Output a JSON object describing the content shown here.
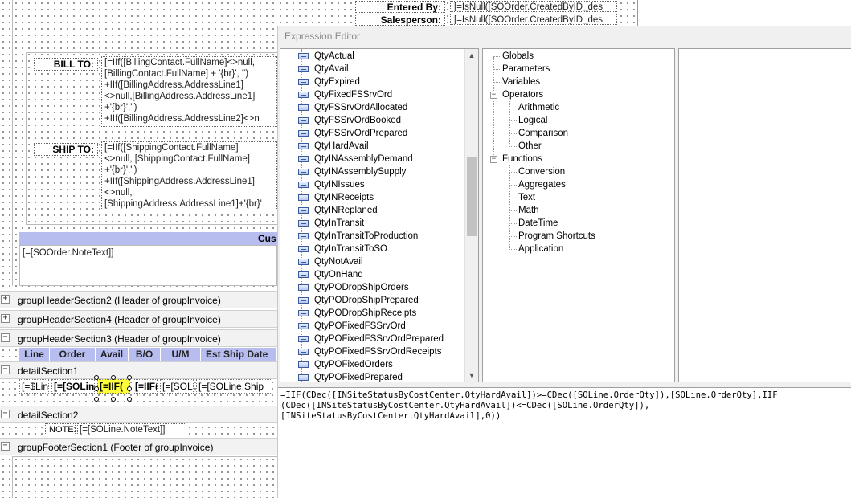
{
  "report": {
    "entered_by_label": "Entered By:",
    "entered_by_value": "[=IsNull([SOOrder.CreatedByID_des",
    "salesperson_label": "Salesperson:",
    "salesperson_value": "[=IsNull([SOOrder.CreatedByID_des",
    "bill_to_label": "BILL TO:",
    "bill_to_lines": [
      "[=IIf([BillingContact.FullName]<>null,",
      "[BillingContact.FullName] + '{br}', '')",
      "+IIf([BillingAddress.AddressLine1]",
      "<>null,[BillingAddress.AddressLine1]",
      "+'{br}','')",
      "+IIf([BillingAddress.AddressLine2]<>n"
    ],
    "ship_to_label": "SHIP TO:",
    "ship_to_lines": [
      "[=IIf([ShippingContact.FullName]",
      "<>null,   [ShippingContact.FullName]",
      "+'{br}','')",
      "+IIf([ShippingAddress.AddressLine1]",
      "<>null,",
      "[ShippingAddress.AddressLine1]+'{br}'"
    ],
    "cus_header": "Cus",
    "note_text": "[=[SOOrder.NoteText]]",
    "sections": {
      "gh2": "groupHeaderSection2 (Header of groupInvoice)",
      "gh4": "groupHeaderSection4 (Header of groupInvoice)",
      "gh3": "groupHeaderSection3 (Header of groupInvoice)",
      "detail1": "detailSection1",
      "detail2": "detailSection2",
      "footer1": "groupFooterSection1 (Footer of groupInvoice)"
    },
    "expanders": {
      "plus": "+",
      "minus": "−"
    },
    "columns": [
      "Line",
      "Order",
      "Avail",
      "B/O",
      "U/M",
      "Est Ship Date"
    ],
    "detail_cells": [
      "[=$Lin",
      "[=[SOLin",
      "[=IIF(",
      "[=IIF(",
      "[=[SOL",
      "[=[SOLine.Ship"
    ],
    "note_label": "NOTE:",
    "note_value": "[=[SOLine.NoteText]]"
  },
  "editor": {
    "title": "Expression Editor",
    "fields": [
      "QtyActual",
      "QtyAvail",
      "QtyExpired",
      "QtyFixedFSSrvOrd",
      "QtyFSSrvOrdAllocated",
      "QtyFSSrvOrdBooked",
      "QtyFSSrvOrdPrepared",
      "QtyHardAvail",
      "QtyINAssemblyDemand",
      "QtyINAssemblySupply",
      "QtyINIssues",
      "QtyINReceipts",
      "QtyINReplaned",
      "QtyInTransit",
      "QtyInTransitToProduction",
      "QtyInTransitToSO",
      "QtyNotAvail",
      "QtyOnHand",
      "QtyPODropShipOrders",
      "QtyPODropShipPrepared",
      "QtyPODropShipReceipts",
      "QtyPOFixedFSSrvOrd",
      "QtyPOFixedFSSrvOrdPrepared",
      "QtyPOFixedFSSrvOrdReceipts",
      "QtyPOFixedOrders",
      "QtyPOFixedPrepared"
    ],
    "tree": {
      "globals": "Globals",
      "parameters": "Parameters",
      "variables": "Variables",
      "operators": "Operators",
      "operator_items": [
        "Arithmetic",
        "Logical",
        "Comparison",
        "Other"
      ],
      "functions": "Functions",
      "function_items": [
        "Conversion",
        "Aggregates",
        "Text",
        "Math",
        "DateTime",
        "Program Shortcuts",
        "Application"
      ]
    },
    "expression_lines": [
      "=IIF(CDec([INSiteStatusByCostCenter.QtyHardAvail])>=CDec([SOLine.OrderQty]),[SOLine.OrderQty],IIF",
      "(CDec([INSiteStatusByCostCenter.QtyHardAvail])<=CDec([SOLine.OrderQty]),",
      "[INSiteStatusByCostCenter.QtyHardAvail],0))"
    ]
  }
}
